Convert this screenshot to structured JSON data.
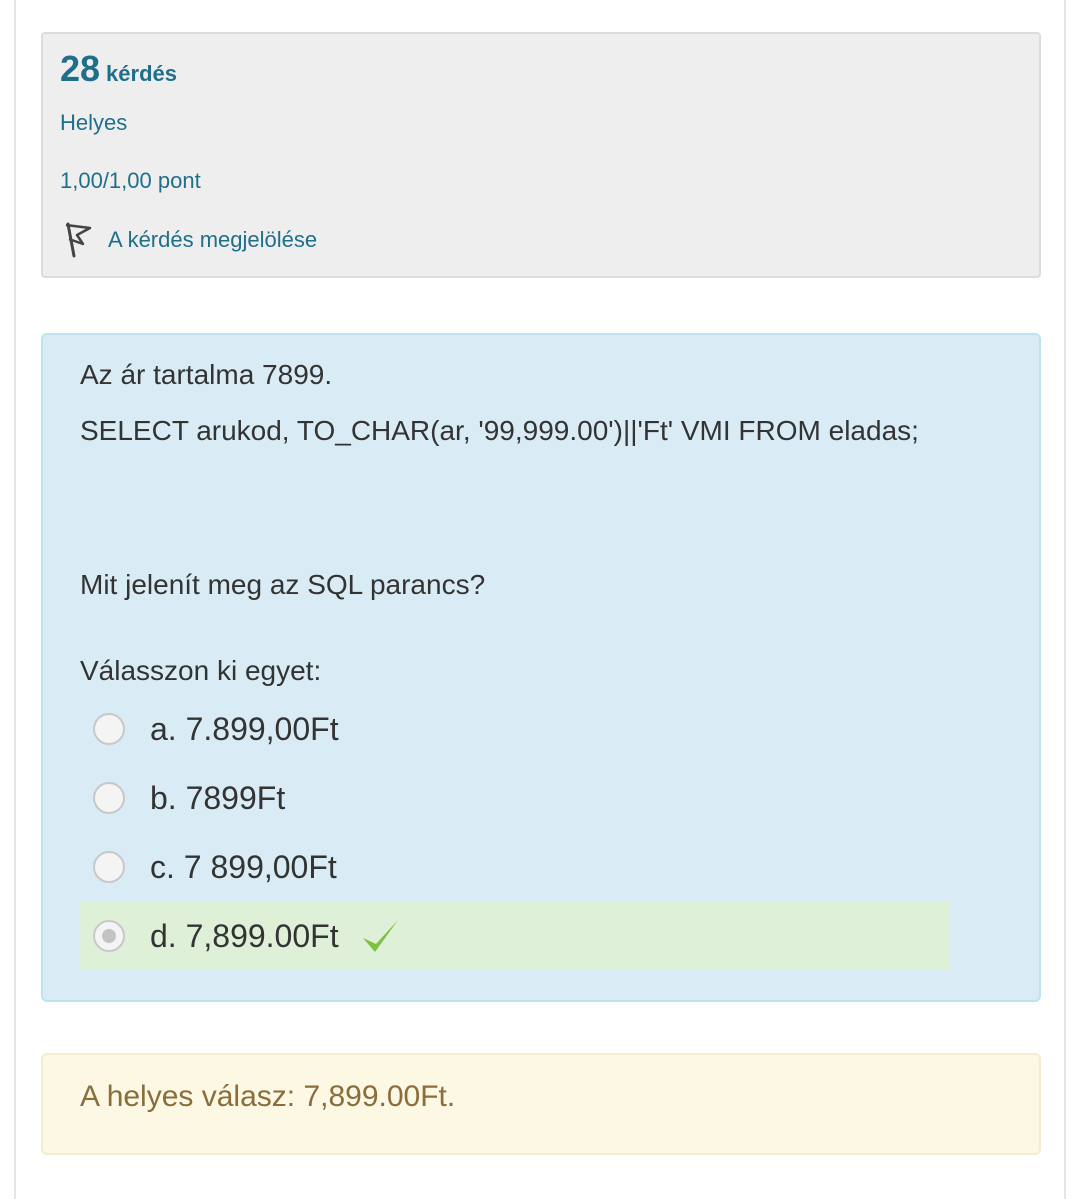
{
  "info": {
    "question_number": "28",
    "question_word": "kérdés",
    "state": "Helyes",
    "grade": "1,00/1,00 pont",
    "flag_label": "A kérdés megjelölése",
    "flag_icon": "flag-icon"
  },
  "question": {
    "line1": "Az ár tartalma 7899.",
    "line2": "SELECT arukod, TO_CHAR(ar, '99,999.00')||'Ft' VMI FROM eladas;",
    "line3": "Mit jelenít meg az SQL parancs?",
    "prompt": "Válasszon ki egyet:"
  },
  "answers": [
    {
      "label": "a. 7.899,00Ft",
      "selected": false,
      "correct": false
    },
    {
      "label": "b. 7899Ft",
      "selected": false,
      "correct": false
    },
    {
      "label": "c. 7 899,00Ft",
      "selected": false,
      "correct": false
    },
    {
      "label": "d. 7,899.00Ft",
      "selected": true,
      "correct": true
    }
  ],
  "feedback": {
    "right_answer": "A helyes válasz: 7,899.00Ft."
  },
  "colors": {
    "link": "#1f6f8b",
    "info_bg": "#eeeeee",
    "content_bg": "#d9ecf5",
    "correct_bg": "#dff0d8",
    "check": "#7cc142",
    "feedback_bg": "#fcf8e3",
    "feedback_text": "#8a6d3b"
  }
}
